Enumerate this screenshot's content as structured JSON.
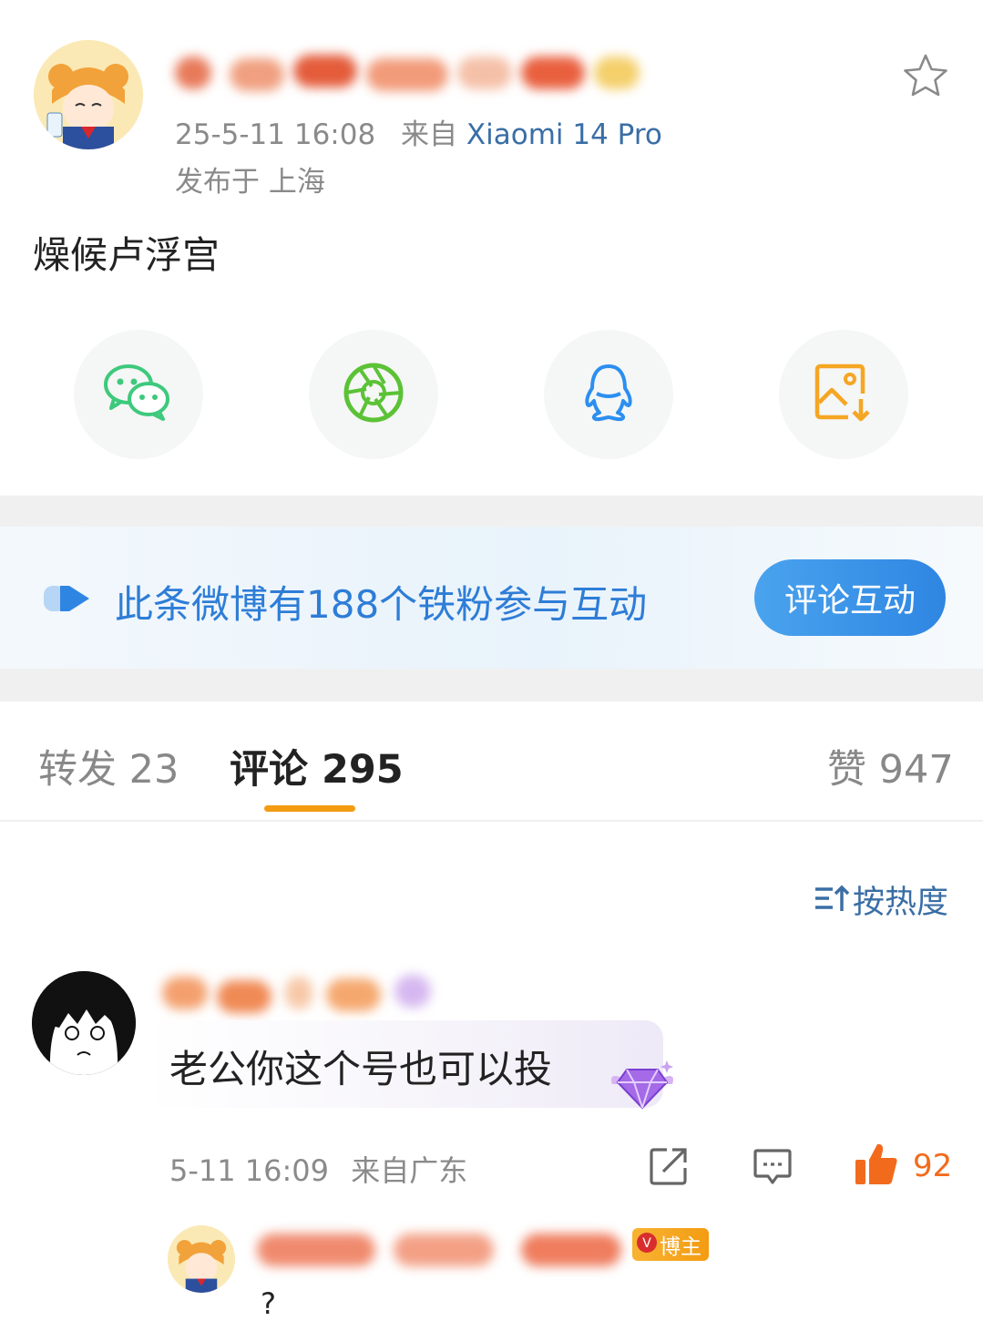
{
  "post": {
    "time": "25-5-11 16:08",
    "from_label": "来自",
    "device": "Xiaomi 14 Pro",
    "location": "发布于 上海",
    "content": "燥候卢浮宫"
  },
  "share": {
    "items": [
      {
        "icon": "wechat-icon"
      },
      {
        "icon": "moments-icon"
      },
      {
        "icon": "qq-icon"
      },
      {
        "icon": "save-image-icon"
      }
    ]
  },
  "banner": {
    "text": "此条微博有188个铁粉参与互动",
    "button": "评论互动"
  },
  "tabs": {
    "repost": "转发 23",
    "comment": "评论 295",
    "like": "赞 947"
  },
  "sort": {
    "label": "按热度"
  },
  "comment": {
    "text": "老公你这个号也可以投",
    "time": "5-11 16:09",
    "location": "来自广东",
    "likes": "92"
  },
  "reply": {
    "badge": "博主",
    "text": "?"
  },
  "colors": {
    "accent_orange": "#f39c12",
    "link_blue": "#3a6ea5",
    "button_blue": "#2f86e2",
    "wechat_green": "#3ec97c",
    "qq_blue": "#2c8ff0",
    "save_orange": "#f5a623",
    "like_orange": "#f26b1d"
  }
}
